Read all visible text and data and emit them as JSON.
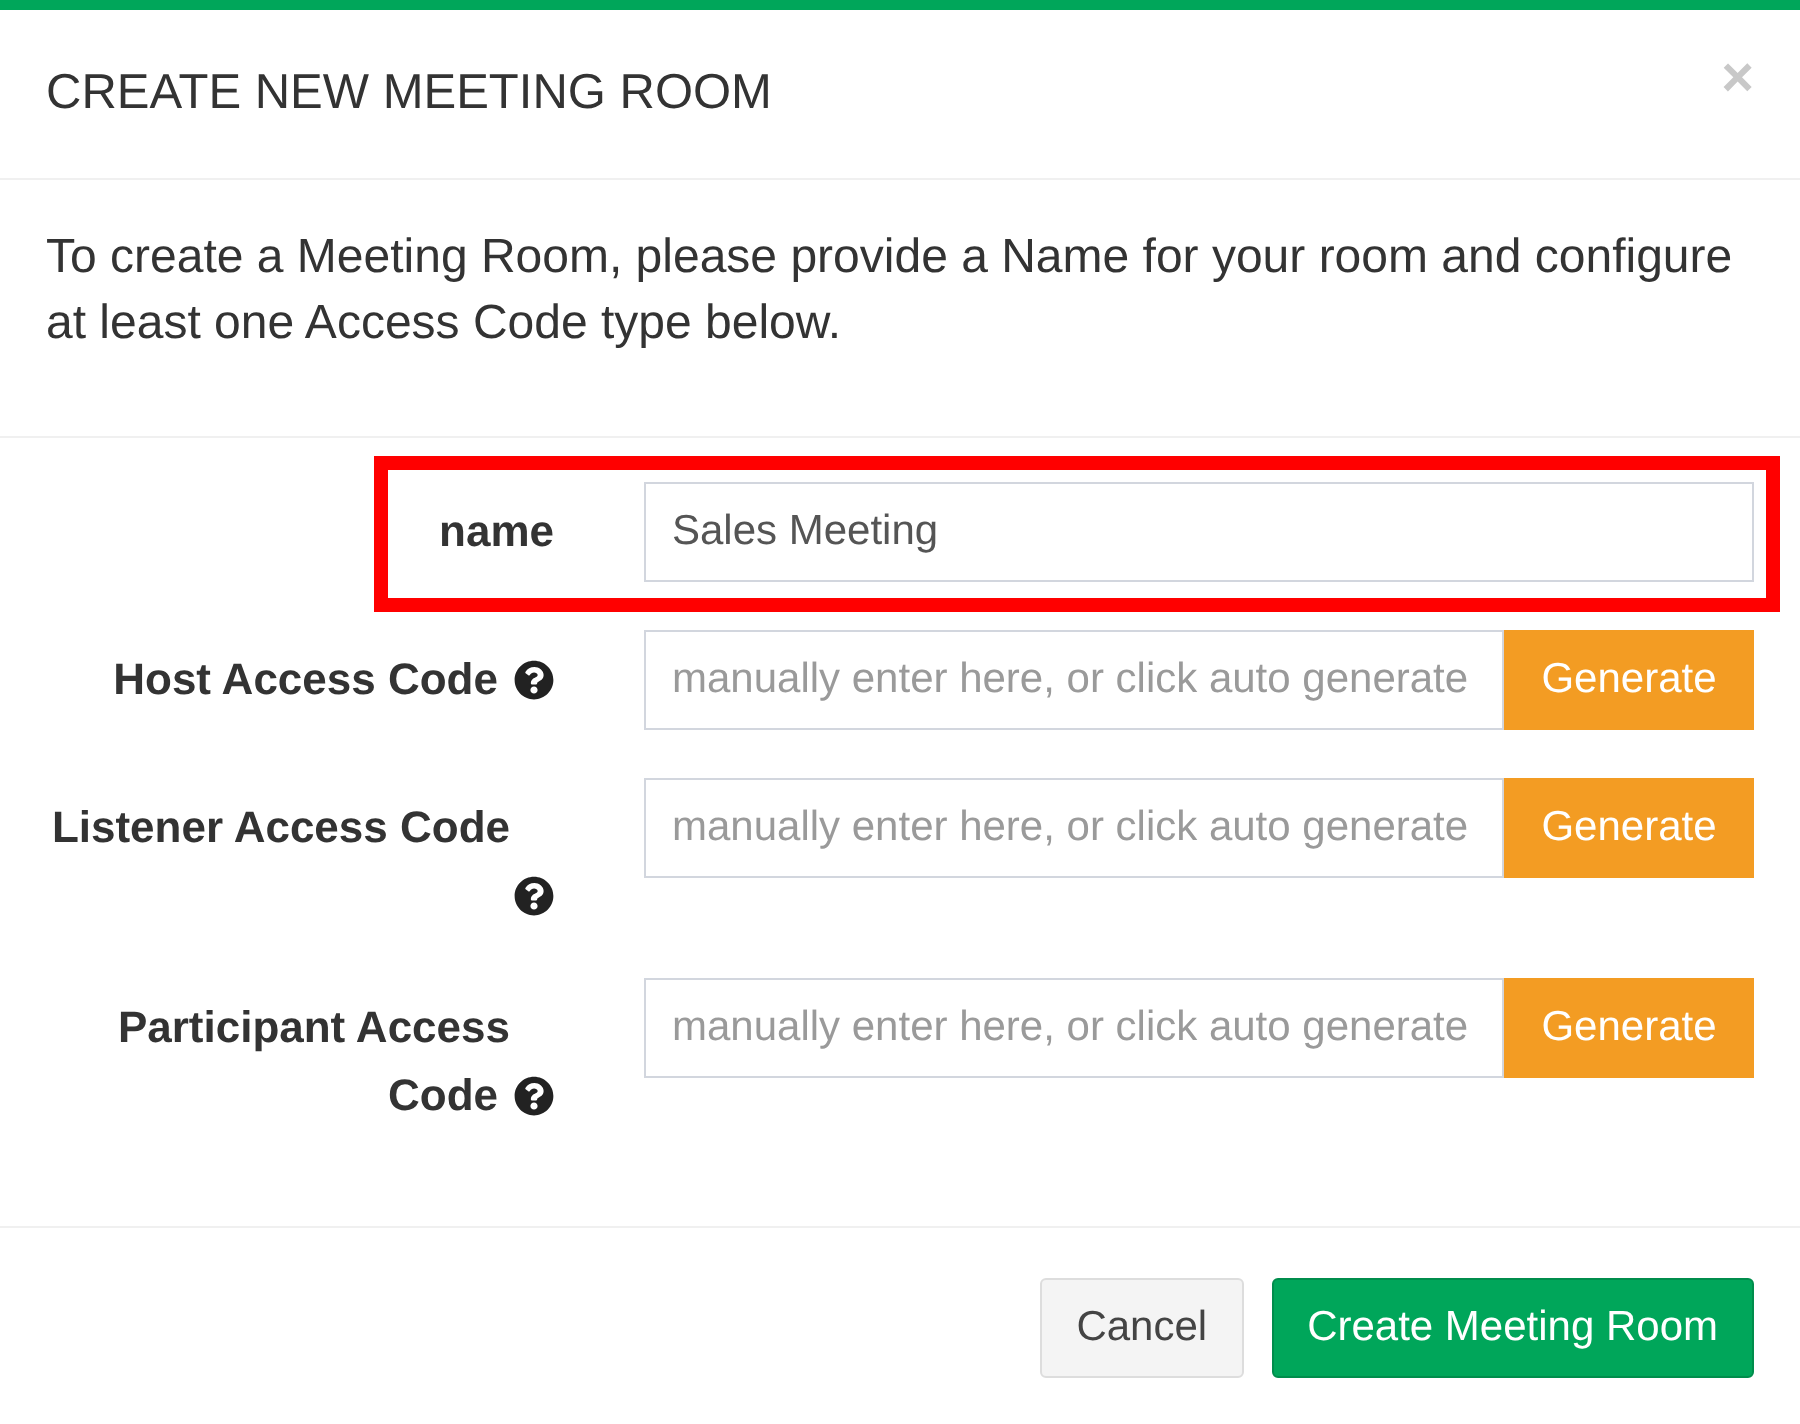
{
  "window": {
    "title": "CREATE NEW MEETING ROOM",
    "close": "×"
  },
  "intro": "To create a Meeting Room, please provide a Name for your room and configure at least one Access Code type below.",
  "fields": [
    {
      "kind": "text",
      "label": "name",
      "value": "Sales Meeting",
      "highlighted": true
    },
    {
      "kind": "code",
      "label": "Host Access Code",
      "placeholder": "manually enter here, or click auto generate",
      "button": "Generate",
      "highlighted": false
    },
    {
      "kind": "code",
      "label": "Listener Access Code",
      "placeholder": "manually enter here, or click auto generate",
      "button": "Generate",
      "highlighted": false
    },
    {
      "kind": "code",
      "label": "Participant Access Code",
      "placeholder": "manually enter here, or click auto generate",
      "button": "Generate",
      "highlighted": false
    }
  ],
  "buttons": [
    {
      "kind": "secondary",
      "label": "Cancel"
    },
    {
      "kind": "primary",
      "label": "Create Meeting Room"
    }
  ]
}
